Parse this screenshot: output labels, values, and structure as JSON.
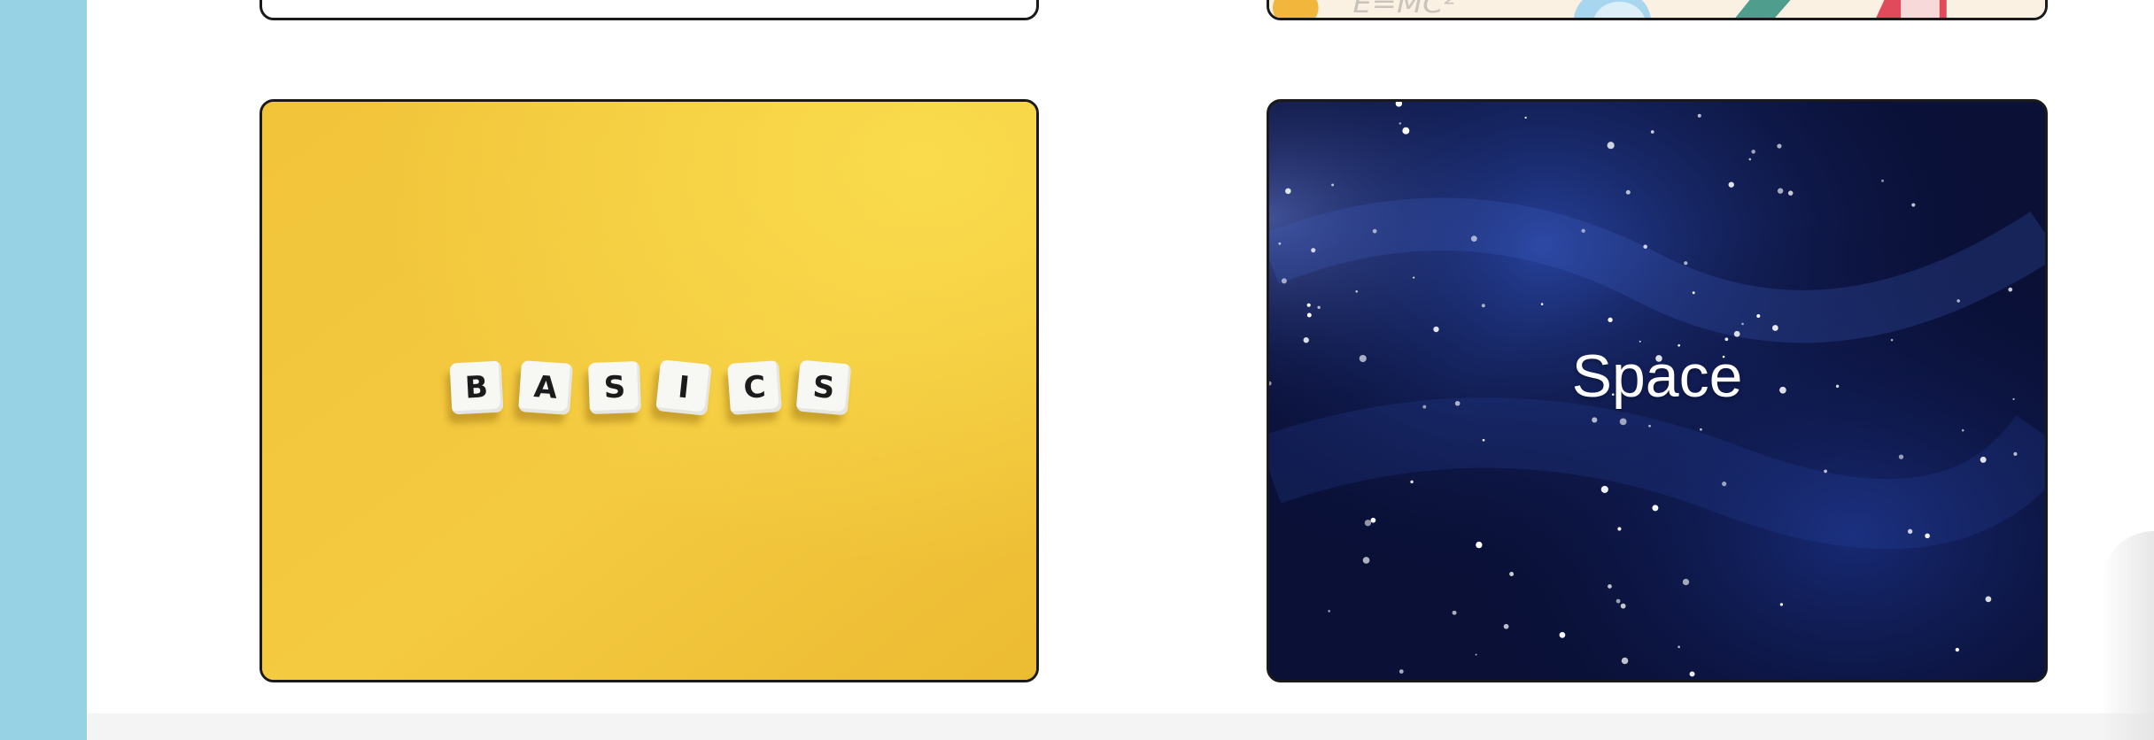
{
  "layout_colors": {
    "left_rail": "#97d1e4",
    "page_background": "#ffffff",
    "card_border": "#1a1a1a",
    "basics_background": "#f2c53b",
    "space_background": "#09113a"
  },
  "cards": {
    "basics": {
      "dice_letters": [
        "B",
        "A",
        "S",
        "I",
        "C",
        "S"
      ]
    },
    "space": {
      "label": "Space"
    }
  }
}
